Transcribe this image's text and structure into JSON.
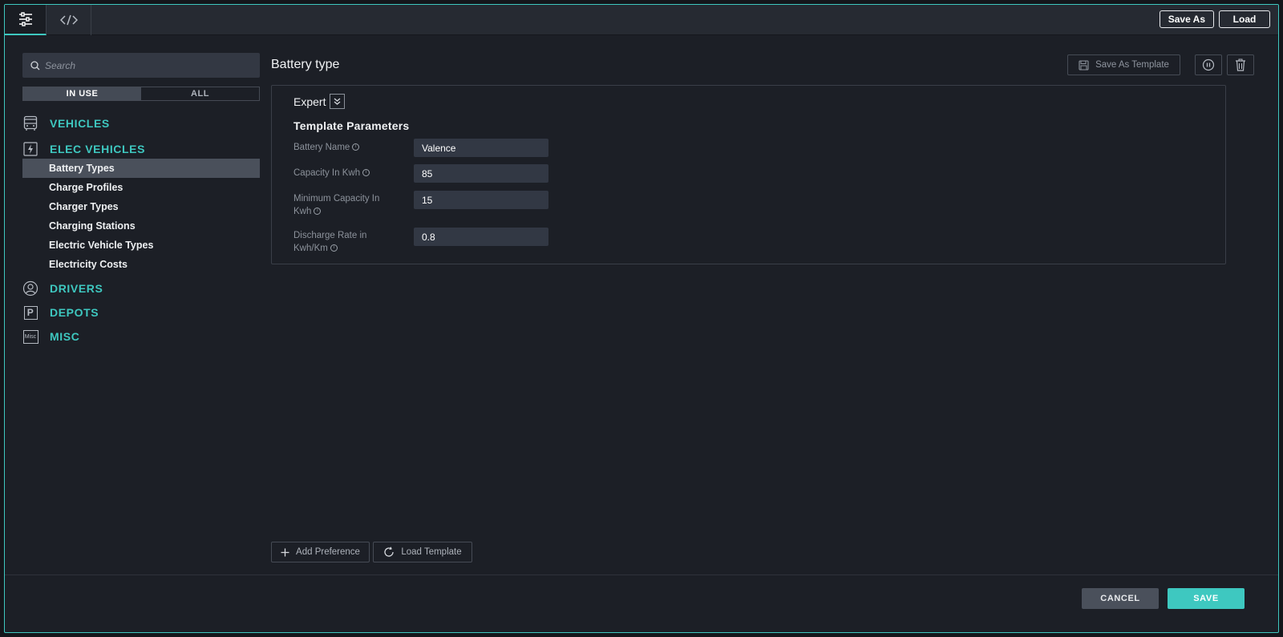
{
  "topbar": {
    "tabs": [
      {
        "icon": "sliders-icon",
        "active": true
      },
      {
        "icon": "code-icon",
        "active": false
      }
    ],
    "save_as_label": "Save As",
    "load_label": "Load"
  },
  "sidebar": {
    "search_placeholder": "Search",
    "segments": {
      "in_use": "IN USE",
      "all": "ALL",
      "selected": "IN USE"
    },
    "categories": [
      {
        "label": "VEHICLES",
        "icon": "bus-icon"
      },
      {
        "label": "ELEC VEHICLES",
        "icon": "lightning-icon",
        "items": [
          "Battery Types",
          "Charge Profiles",
          "Charger Types",
          "Charging Stations",
          "Electric Vehicle Types",
          "Electricity Costs"
        ],
        "selected_item": "Battery Types"
      },
      {
        "label": "DRIVERS",
        "icon": "user-circle-icon"
      },
      {
        "label": "DEPOTS",
        "icon": "parking-icon",
        "icon_text": "P"
      },
      {
        "label": "MISC",
        "icon": "misc-icon",
        "icon_text": "Misc"
      }
    ]
  },
  "main": {
    "title": "Battery type",
    "save_as_template_label": "Save As Template",
    "expert_label": "Expert",
    "template_params_title": "Template Parameters",
    "params": [
      {
        "label": "Battery Name",
        "value": "Valence"
      },
      {
        "label": "Capacity In Kwh",
        "value": "85"
      },
      {
        "label": "Minimum Capacity In Kwh",
        "value": "15"
      },
      {
        "label": "Discharge Rate in Kwh/Km",
        "value": "0.8"
      }
    ],
    "add_preference_label": "Add Preference",
    "load_template_label": "Load Template"
  },
  "footer": {
    "cancel_label": "CANCEL",
    "save_label": "SAVE"
  },
  "colors": {
    "accent": "#3ec8c0",
    "panel_bg": "#1c1f26",
    "field_bg": "#323844"
  }
}
